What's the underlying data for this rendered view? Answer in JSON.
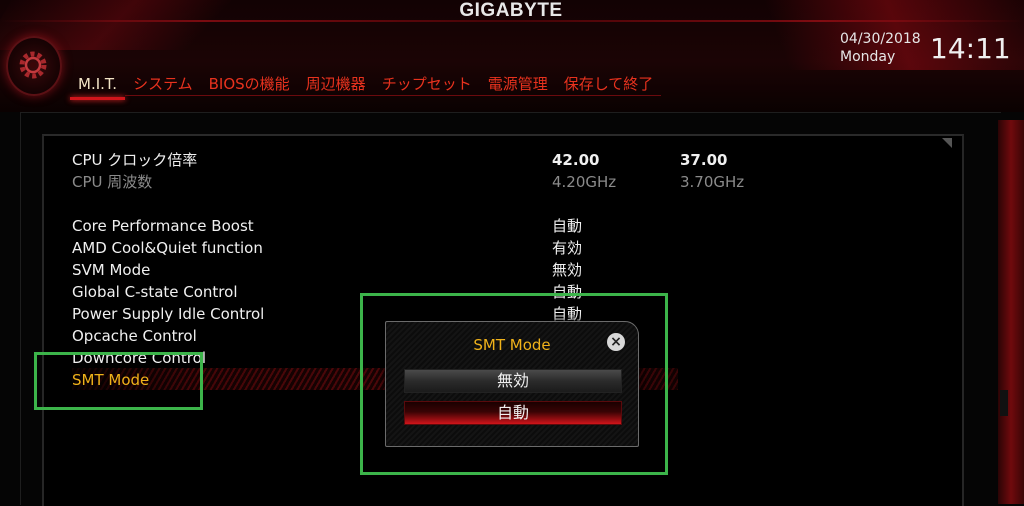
{
  "header": {
    "brand": "GIGABYTE",
    "date": "04/30/2018",
    "weekday": "Monday",
    "time": "14:11",
    "accent_color": "#d0151b",
    "tabs": [
      {
        "label": "M.I.T.",
        "active": true
      },
      {
        "label": "システム",
        "active": false
      },
      {
        "label": "BIOSの機能",
        "active": false
      },
      {
        "label": "周辺機器",
        "active": false
      },
      {
        "label": "チップセット",
        "active": false
      },
      {
        "label": "電源管理",
        "active": false
      },
      {
        "label": "保存して終了",
        "active": false
      }
    ]
  },
  "settings": {
    "cpu_ratio": {
      "label": "CPU クロック倍率",
      "value1": "42.00",
      "value2": "37.00"
    },
    "cpu_freq": {
      "label": "CPU 周波数",
      "value1": "4.20GHz",
      "value2": "3.70GHz"
    },
    "items": [
      {
        "label": "Core Performance Boost",
        "value": "自動"
      },
      {
        "label": "AMD Cool&Quiet function",
        "value": "有効"
      },
      {
        "label": "SVM Mode",
        "value": "無効"
      },
      {
        "label": "Global C-state Control",
        "value": "自動"
      },
      {
        "label": "Power Supply Idle Control",
        "value": "自動"
      },
      {
        "label": "Opcache Control",
        "value": ""
      },
      {
        "label": "Downcore Control",
        "value": ""
      },
      {
        "label": "SMT Mode",
        "value": "",
        "selected": true
      }
    ]
  },
  "popup": {
    "title": "SMT Mode",
    "close_icon": "close-icon",
    "options": [
      "無効",
      "自動"
    ],
    "highlighted_option": "自動"
  },
  "annotation_color": "#3cb44a"
}
